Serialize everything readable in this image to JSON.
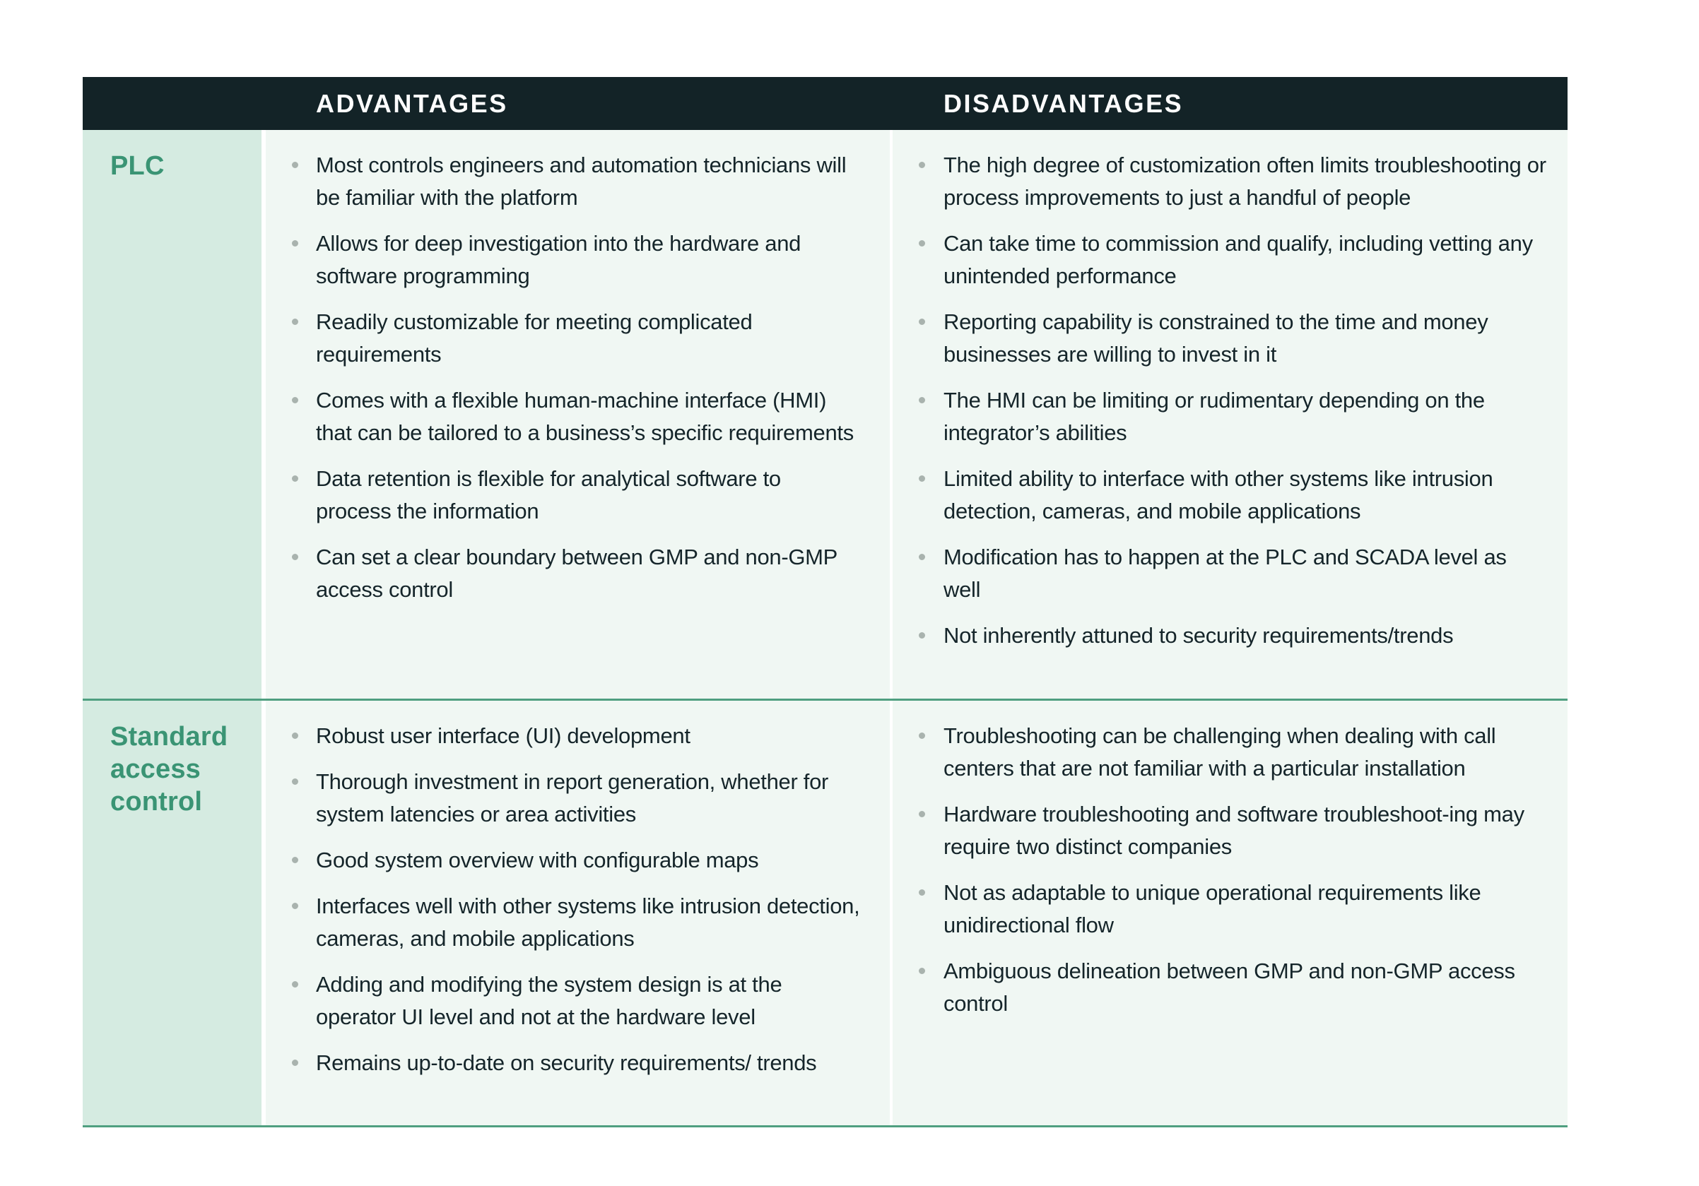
{
  "header": {
    "label_column": "",
    "advantages": "ADVANTAGES",
    "disadvantages": "DISADVANTAGES"
  },
  "colors": {
    "header_bg": "#132327",
    "label_bg": "#d5ebe1",
    "cell_bg": "#f0f7f3",
    "label_text": "#3a9474",
    "divider": "#4f9f80",
    "bullet": "#a9b3ae"
  },
  "rows": [
    {
      "label": "PLC",
      "advantages": [
        "Most controls engineers and automation technicians will be familiar with the platform",
        "Allows for deep investigation into the hardware and software programming",
        "Readily customizable for meeting complicated requirements",
        "Comes with a flexible human-machine interface (HMI) that can be tailored to a business’s specific requirements",
        "Data retention is flexible for analytical software to process the information",
        "Can set a clear boundary between GMP and non-GMP access control"
      ],
      "disadvantages": [
        "The high degree of customization often limits troubleshooting or process improvements to just a handful of people",
        "Can take time to commission and qualify, including vetting any unintended performance",
        "Reporting capability is constrained to the time and money businesses are willing to invest in it",
        "The HMI can be limiting or rudimentary depending on the integrator’s abilities",
        "Limited ability to interface with other systems like intrusion detection, cameras, and mobile applications",
        "Modification has to happen at the PLC and SCADA level as well",
        "Not inherently attuned to security requirements/trends"
      ]
    },
    {
      "label": "Standard\naccess\ncontrol",
      "advantages": [
        "Robust user interface (UI) development",
        "Thorough investment in report generation, whether for system latencies or area activities",
        "Good system overview with configurable maps",
        "Interfaces well with other systems like intrusion detection, cameras, and mobile applications",
        "Adding and modifying the system design is at the operator UI level and not at the hardware level",
        "Remains up-to-date on security requirements/ trends"
      ],
      "disadvantages": [
        "Troubleshooting can be challenging when dealing with call centers that are not familiar with a particular installation",
        "Hardware troubleshooting and software troubleshoot-ing may require two distinct companies",
        "Not as adaptable to unique operational requirements like unidirectional flow",
        "Ambiguous delineation between GMP and non-GMP access control"
      ]
    }
  ]
}
